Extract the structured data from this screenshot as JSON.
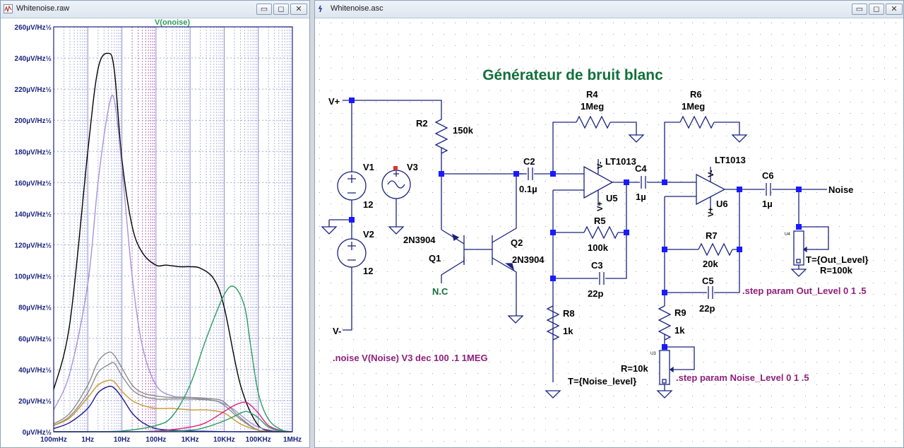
{
  "plot_window": {
    "title": "Whitenoise.raw",
    "trace_label": "V(onoise)",
    "y_ticks": [
      "260µV/Hz½",
      "240µV/Hz½",
      "220µV/Hz½",
      "200µV/Hz½",
      "180µV/Hz½",
      "160µV/Hz½",
      "140µV/Hz½",
      "120µV/Hz½",
      "100µV/Hz½",
      "80µV/Hz½",
      "60µV/Hz½",
      "40µV/Hz½",
      "20µV/Hz½",
      "0µV/Hz½"
    ],
    "x_ticks": [
      "100mHz",
      "1Hz",
      "10Hz",
      "100Hz",
      "1KHz",
      "10KHz",
      "100KHz",
      "1MHz"
    ],
    "buttons": {
      "minimize": "▭",
      "maximize": "◻",
      "close": "✕"
    }
  },
  "chart_data": {
    "type": "line",
    "title": "V(onoise)",
    "xlabel": "",
    "ylabel": "",
    "x_scale": "log",
    "xlim": [
      0.1,
      1000000
    ],
    "ylim": [
      0,
      260
    ],
    "grid": true,
    "series": [
      {
        "color": "#000000",
        "x": [
          0.1,
          0.3,
          1,
          2,
          4,
          6,
          10,
          20,
          40,
          100,
          200,
          500,
          1000,
          2000,
          5000,
          10000,
          30000,
          100000,
          300000,
          1000000
        ],
        "y": [
          27,
          70,
          180,
          233,
          243,
          232,
          175,
          132,
          115,
          107,
          107,
          106,
          106,
          105,
          98,
          80,
          30,
          4,
          0.5,
          0
        ]
      },
      {
        "color": "#a892d8",
        "x": [
          0.1,
          0.3,
          1,
          2,
          4,
          6,
          10,
          20,
          40,
          100,
          300,
          1000,
          10000,
          100000,
          1000000
        ],
        "y": [
          14,
          38,
          95,
          160,
          207,
          213,
          170,
          100,
          55,
          30,
          23,
          22,
          18,
          3,
          0
        ]
      },
      {
        "color": "#8c8c8c",
        "x": [
          0.1,
          0.3,
          1,
          2,
          4,
          6,
          10,
          20,
          40,
          100,
          300,
          1000,
          5000,
          10000,
          30000,
          100000,
          300000,
          1000000
        ],
        "y": [
          5,
          12,
          30,
          45,
          51,
          49,
          41,
          30,
          25,
          23,
          22,
          22,
          21,
          19,
          9,
          1,
          0,
          0
        ]
      },
      {
        "color": "#8c8c8c",
        "x": [
          0.1,
          0.3,
          1,
          2,
          4,
          6,
          10,
          20,
          40,
          100,
          300,
          1000,
          5000,
          10000,
          30000,
          100000,
          300000,
          1000000
        ],
        "y": [
          4,
          10,
          25,
          38,
          43,
          44,
          36,
          27,
          23,
          21,
          21,
          21,
          20,
          17,
          8,
          1,
          0,
          0
        ]
      },
      {
        "color": "#c8962a",
        "x": [
          0.1,
          0.3,
          1,
          2,
          4,
          6,
          10,
          20,
          40,
          100,
          300,
          1000,
          3000,
          10000,
          30000,
          100000,
          300000,
          1000000
        ],
        "y": [
          4,
          9,
          22,
          30,
          33,
          32,
          26,
          20,
          17,
          15,
          15,
          14,
          14,
          12,
          5,
          1,
          0,
          0
        ]
      },
      {
        "color": "#1a1a8c",
        "x": [
          0.1,
          0.3,
          1,
          2,
          4,
          6,
          10,
          20,
          40,
          100,
          300,
          1000,
          3000,
          10000,
          30000,
          100000,
          1000000
        ],
        "y": [
          2,
          6,
          15,
          25,
          29,
          28,
          22,
          12,
          6,
          2,
          1,
          0.5,
          0.3,
          0.1,
          0,
          0,
          0
        ]
      },
      {
        "color": "#2a9e5c",
        "x": [
          0.1,
          1,
          10,
          100,
          300,
          1000,
          3000,
          10000,
          20000,
          40000,
          60000,
          100000,
          200000,
          500000,
          1000000
        ],
        "y": [
          0,
          0,
          0.5,
          4,
          10,
          30,
          60,
          88,
          93,
          80,
          55,
          25,
          8,
          1,
          0
        ]
      },
      {
        "color": "#e02080",
        "x": [
          0.1,
          10,
          100,
          1000,
          3000,
          10000,
          20000,
          40000,
          60000,
          100000,
          200000,
          500000,
          1000000
        ],
        "y": [
          0,
          0,
          0.5,
          3,
          6,
          13,
          17,
          19,
          17,
          12,
          4,
          0.5,
          0
        ]
      },
      {
        "color": "#2a9e5c",
        "x": [
          0.1,
          10,
          100,
          1000,
          3000,
          10000,
          20000,
          40000,
          60000,
          100000,
          200000,
          500000,
          1000000
        ],
        "y": [
          0,
          0,
          0.2,
          1,
          3,
          7,
          10,
          13,
          12,
          9,
          3,
          0.3,
          0
        ]
      }
    ]
  },
  "schematic_window": {
    "title": "Whitenoise.asc",
    "buttons": {
      "minimize": "▭",
      "maximize": "◻",
      "close": "✕"
    },
    "heading": "Générateur de bruit blanc",
    "labels": {
      "vplus": "V+",
      "vminus": "V-",
      "v1": "V1",
      "v1_val": "12",
      "v2": "V2",
      "v2_val": "12",
      "v3": "V3",
      "r2": "R2",
      "r2_val": "150k",
      "q1_model": "2N3904",
      "q1": "Q1",
      "q2": "Q2",
      "q2_model": "2N3904",
      "nc": "N.C",
      "c2": "C2",
      "c2_val": "0.1µ",
      "r4": "R4",
      "r4_val": "1Meg",
      "u5_model": "LT1013",
      "u5": "U5",
      "c4": "C4",
      "c4_val": "1µ",
      "r5": "R5",
      "r5_val": "100k",
      "c3": "C3",
      "c3_val": "22p",
      "r8": "R8",
      "r8_val": "1k",
      "r6": "R6",
      "r6_val": "1Meg",
      "u6_model": "LT1013",
      "u6": "U6",
      "c6": "C6",
      "c6_val": "1µ",
      "noise": "Noise",
      "r7": "R7",
      "r7_val": "20k",
      "c5": "C5",
      "c5_val": "22p",
      "r9": "R9",
      "r9_val": "1k",
      "u4": "U4",
      "u4_t": "T={Out_Level}",
      "u4_r": "R=100k",
      "u3": "U3",
      "u3_r": "R=10k",
      "u3_t": "T={Noise_level}",
      "vminus_pin": "V-",
      "vplus_pin": "V+",
      "noise_cmd": ".noise V(Noise) V3 dec 100 .1 1MEG",
      "step_out": ".step param Out_Level 0 1 .5",
      "step_noise": ".step param Noise_Level 0 1 .5"
    }
  }
}
